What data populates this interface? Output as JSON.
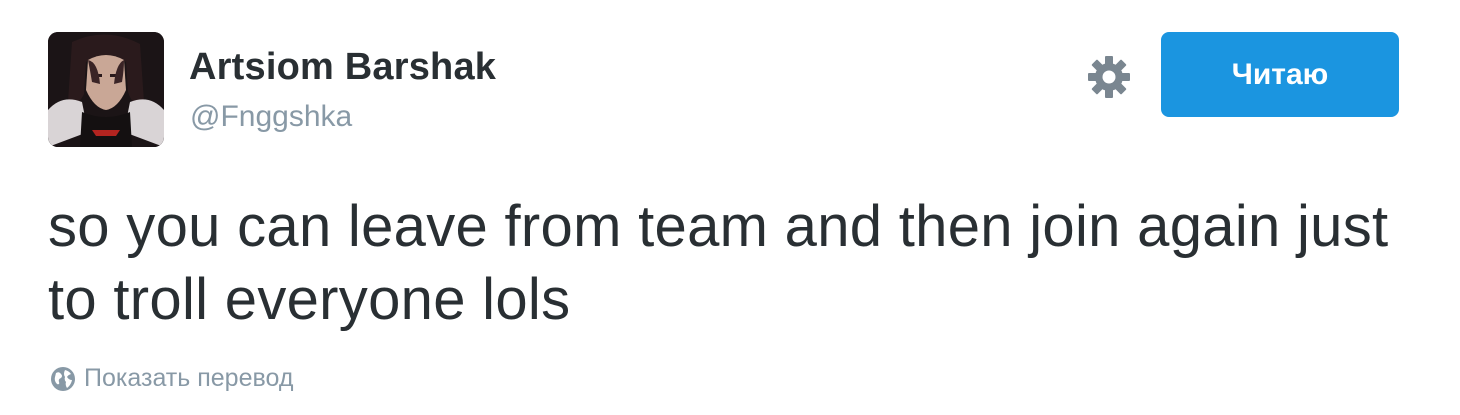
{
  "user": {
    "display_name": "Artsiom Barshak",
    "screen_name": "@Fnggshka",
    "avatar_icon": "user-avatar"
  },
  "actions": {
    "settings_icon": "gear-icon",
    "follow_label": "Читаю"
  },
  "tweet": {
    "text": "so you can leave from team and then join again just to troll everyone lols"
  },
  "translate": {
    "icon": "globe-icon",
    "label": "Показать перевод"
  },
  "colors": {
    "follow_button": "#1b95e0",
    "secondary_text": "#8899a6",
    "primary_text": "#292f33"
  }
}
